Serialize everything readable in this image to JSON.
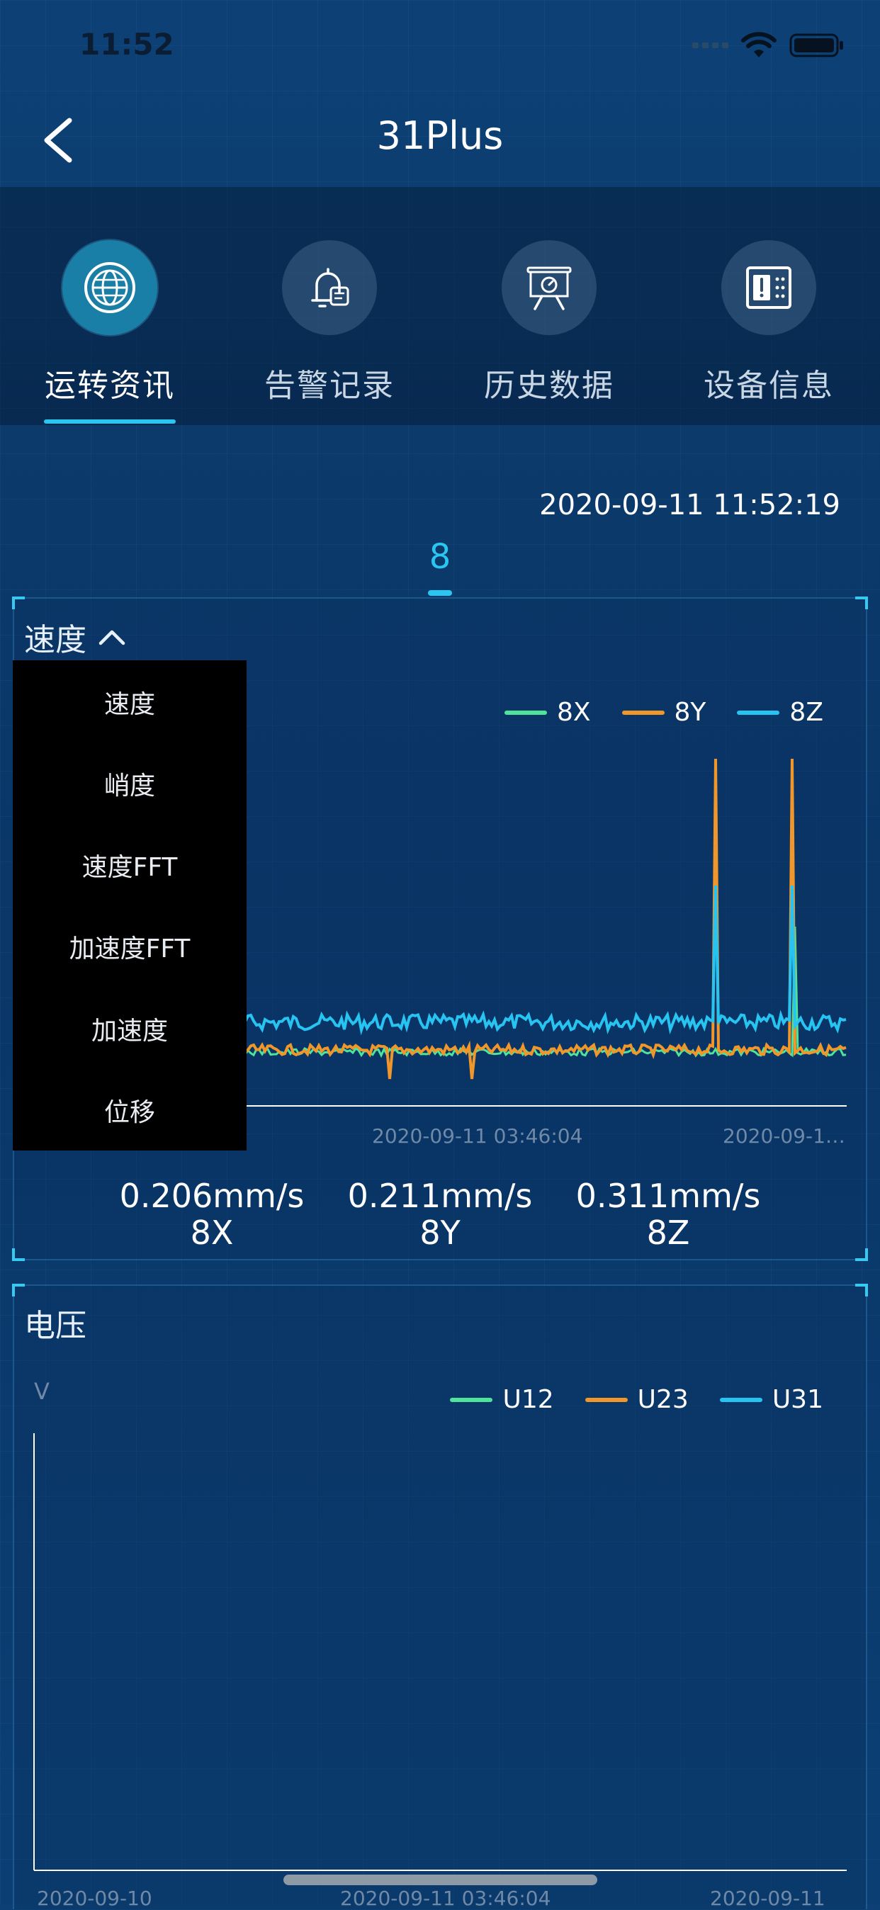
{
  "status_bar": {
    "time": "11:52"
  },
  "nav": {
    "title": "31Plus"
  },
  "tabs": [
    {
      "label": "运转资讯",
      "icon": "globe-icon",
      "active": true
    },
    {
      "label": "告警记录",
      "icon": "alarm-bell-icon",
      "active": false
    },
    {
      "label": "历史数据",
      "icon": "presentation-gauge-icon",
      "active": false
    },
    {
      "label": "设备信息",
      "icon": "device-info-icon",
      "active": false
    }
  ],
  "timestamp": "2020-09-11 11:52:19",
  "sensor_tab": "8",
  "colors": {
    "accent": "#2bc6f0",
    "series_x": "#4ee59a",
    "series_y": "#f0962a",
    "series_z": "#27c4f2"
  },
  "speed_panel": {
    "title": "速度",
    "dropdown_open": true,
    "dropdown_items": [
      "速度",
      "峭度",
      "速度FFT",
      "加速度FFT",
      "加速度",
      "位移"
    ],
    "legend": [
      "8X",
      "8Y",
      "8Z"
    ],
    "x_ticks": [
      "2020-09-11 03:46:04",
      "2020-09-1…"
    ],
    "values": [
      {
        "value": "0.206mm/s",
        "label": "8X"
      },
      {
        "value": "0.211mm/s",
        "label": "8Y"
      },
      {
        "value": "0.311mm/s",
        "label": "8Z"
      }
    ]
  },
  "voltage_panel": {
    "title": "电压",
    "unit": "V",
    "legend": [
      "U12",
      "U23",
      "U31"
    ],
    "x_ticks": [
      "2020-09-10",
      "2020-09-11 03:46:04",
      "2020-09-11"
    ]
  }
}
